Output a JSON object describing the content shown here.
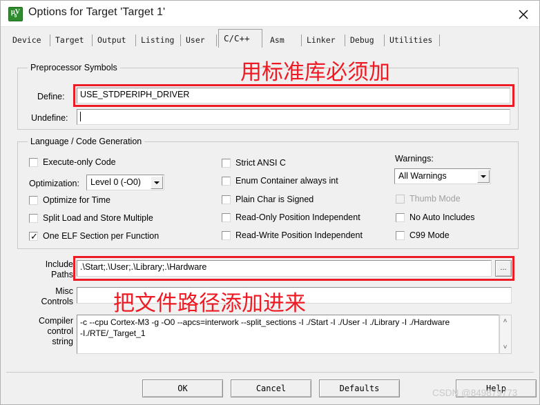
{
  "window": {
    "title": "Options for Target 'Target 1'",
    "icon_name": "keil-uvision-icon",
    "icon_glyph_top": "μV",
    "icon_glyph_bottom": "5",
    "close_label": "✕"
  },
  "tabs": [
    {
      "label": "Device",
      "active": false
    },
    {
      "label": "Target",
      "active": false
    },
    {
      "label": "Output",
      "active": false
    },
    {
      "label": "Listing",
      "active": false
    },
    {
      "label": "User",
      "active": false
    },
    {
      "label": "C/C++",
      "active": true
    },
    {
      "label": "Asm",
      "active": false
    },
    {
      "label": "Linker",
      "active": false
    },
    {
      "label": "Debug",
      "active": false
    },
    {
      "label": "Utilities",
      "active": false
    }
  ],
  "preprocessor": {
    "group_title": "Preprocessor Symbols",
    "define_label": "Define:",
    "define_value": "USE_STDPERIPH_DRIVER",
    "undefine_label": "Undefine:",
    "undefine_value": ""
  },
  "language": {
    "group_title": "Language / Code Generation",
    "left_items": [
      {
        "label": "Execute-only Code",
        "checked": false,
        "disabled": false
      },
      {
        "label": "Optimize for Time",
        "checked": false,
        "disabled": false
      },
      {
        "label": "Split Load and Store Multiple",
        "checked": false,
        "disabled": false
      },
      {
        "label": "One ELF Section per Function",
        "checked": true,
        "disabled": false
      }
    ],
    "optimization_label": "Optimization:",
    "optimization_value": "Level 0 (-O0)",
    "middle_items": [
      {
        "label": "Strict ANSI C",
        "checked": false,
        "disabled": false
      },
      {
        "label": "Enum Container always int",
        "checked": false,
        "disabled": false
      },
      {
        "label": "Plain Char is Signed",
        "checked": false,
        "disabled": false
      },
      {
        "label": "Read-Only Position Independent",
        "checked": false,
        "disabled": false
      },
      {
        "label": "Read-Write Position Independent",
        "checked": false,
        "disabled": false
      }
    ],
    "warnings_label": "Warnings:",
    "warnings_value": "All Warnings",
    "right_items": [
      {
        "label": "Thumb Mode",
        "checked": false,
        "disabled": true
      },
      {
        "label": "No Auto Includes",
        "checked": false,
        "disabled": false
      },
      {
        "label": "C99 Mode",
        "checked": false,
        "disabled": false
      }
    ]
  },
  "paths": {
    "include_label_line1": "Include",
    "include_label_line2": "Paths",
    "include_value": ".\\Start;.\\User;.\\Library;.\\Hardware",
    "browse_label": "...",
    "misc_label_line1": "Misc",
    "misc_label_line2": "Controls",
    "misc_value": "",
    "compiler_label_line1": "Compiler",
    "compiler_label_line2": "control",
    "compiler_label_line3": "string",
    "compiler_value_line1": "-c --cpu Cortex-M3 -g -O0 --apcs=interwork --split_sections -I ./Start -I ./User -I ./Library -I ./Hardware",
    "compiler_value_line2": "-I./RTE/_Target_1",
    "scroll_up": "˄",
    "scroll_down": "˅"
  },
  "footer": {
    "ok_label": "OK",
    "cancel_label": "Cancel",
    "defaults_label": "Defaults",
    "help_label": "Help"
  },
  "annotations": {
    "top_note": "用标准库必须加",
    "bottom_note": "把文件路径添加进来",
    "color": "#ee1b24"
  },
  "watermark": {
    "text": "CSDN @849879773"
  }
}
